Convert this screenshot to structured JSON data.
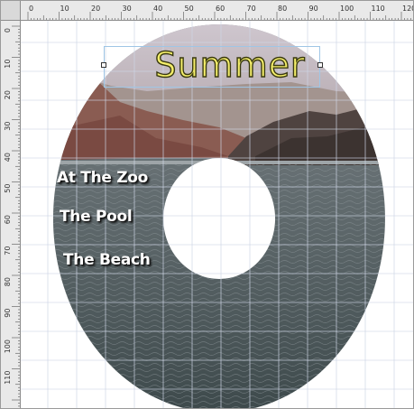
{
  "ruler": {
    "horizontal_labels": [
      "0",
      "10",
      "20",
      "30",
      "40",
      "50",
      "60",
      "70",
      "80",
      "90",
      "100",
      "110",
      "120"
    ],
    "vertical_labels": [
      "0",
      "10",
      "20",
      "30",
      "40",
      "50",
      "60",
      "70",
      "80",
      "90",
      "100",
      "110"
    ]
  },
  "disc": {
    "title": "Summer",
    "items": [
      "At The Zoo",
      "The Pool",
      "The Beach"
    ]
  },
  "colors": {
    "title_fill": "#f4ee6a",
    "title_outline": "#3a3a10",
    "grid": "#cfd6e6",
    "selection": "#9fc6e6"
  }
}
